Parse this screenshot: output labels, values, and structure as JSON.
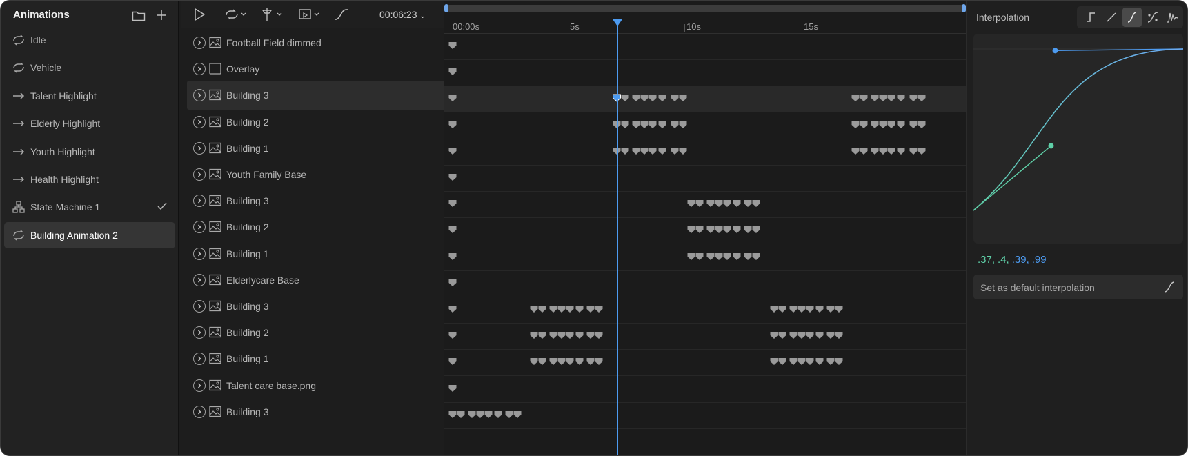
{
  "animations_panel": {
    "title": "Animations",
    "items": [
      {
        "label": "Idle",
        "icon": "loop-icon"
      },
      {
        "label": "Vehicle",
        "icon": "loop-icon"
      },
      {
        "label": "Talent Highlight",
        "icon": "arrow-right-icon"
      },
      {
        "label": "Elderly Highlight",
        "icon": "arrow-right-icon"
      },
      {
        "label": "Youth Highlight",
        "icon": "arrow-right-icon"
      },
      {
        "label": "Health Highlight",
        "icon": "arrow-right-icon"
      },
      {
        "label": "State Machine 1",
        "icon": "state-machine-icon",
        "checked": true
      },
      {
        "label": "Building Animation 2",
        "icon": "loop-icon",
        "selected": true
      }
    ]
  },
  "toolbar": {
    "time": "00:06:23"
  },
  "timeline": {
    "ruler_labels": [
      "00:00s",
      "5s",
      "10s",
      "15s"
    ],
    "playhead_color": "#4d9bf0"
  },
  "layers": [
    {
      "label": "Football Field dimmed",
      "type": "image"
    },
    {
      "label": "Overlay",
      "type": "group"
    },
    {
      "label": "Building 3",
      "type": "image",
      "selected": true
    },
    {
      "label": "Building 2",
      "type": "image"
    },
    {
      "label": "Building 1",
      "type": "image"
    },
    {
      "label": "Youth Family Base",
      "type": "image"
    },
    {
      "label": "Building 3",
      "type": "image"
    },
    {
      "label": "Building 2",
      "type": "image"
    },
    {
      "label": "Building 1",
      "type": "image"
    },
    {
      "label": "Elderlycare Base",
      "type": "image"
    },
    {
      "label": "Building 3",
      "type": "image"
    },
    {
      "label": "Building 2",
      "type": "image"
    },
    {
      "label": "Building 1",
      "type": "image"
    },
    {
      "label": "Talent care base.png",
      "type": "image"
    },
    {
      "label": "Building 3",
      "type": "image"
    }
  ],
  "interpolation": {
    "title": "Interpolation",
    "modes": [
      "hold-icon",
      "linear-icon",
      "cubic-icon",
      "bezier-handles-icon",
      "elastic-icon"
    ],
    "active_mode": "cubic-icon",
    "curve": {
      "x1": 0.37,
      "y1": 0.4,
      "x2": 0.39,
      "y2": 0.99
    },
    "values_text": [
      ".37,",
      ".4,",
      ".39,",
      ".99"
    ],
    "values_colors": [
      "#5fd0a8",
      "#5fd0a8",
      "#4d9bf0",
      "#4d9bf0"
    ],
    "default_button": "Set as default interpolation"
  }
}
